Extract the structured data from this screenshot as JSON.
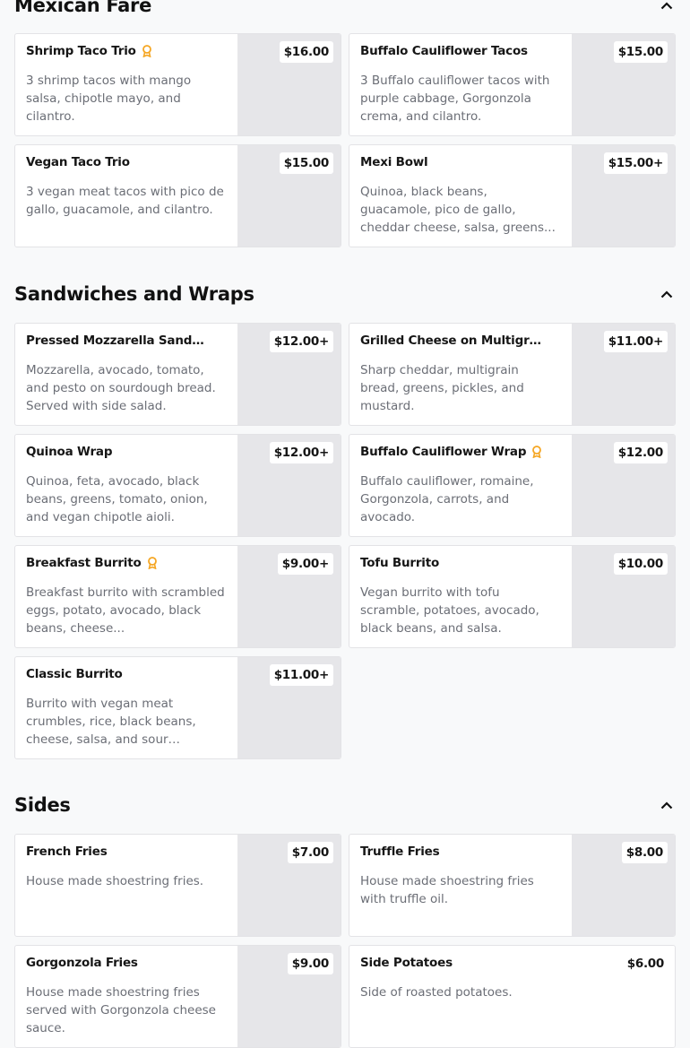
{
  "sections": [
    {
      "title": "Mexican Fare",
      "items": [
        {
          "name": "Shrimp Taco Trio",
          "desc": "3 shrimp tacos with mango salsa, chipotle mayo, and cilantro.",
          "price": "$16.00"
        },
        {
          "name": "Buffalo Cauliflower Tacos",
          "desc": "3 Buffalo cauliflower tacos with purple cabbage, Gorgonzola crema, and cilantro.",
          "price": "$15.00"
        },
        {
          "name": "Vegan Taco Trio",
          "desc": "3 vegan meat tacos with pico de gallo, guacamole, and cilantro.",
          "price": "$15.00"
        },
        {
          "name": "Mexi Bowl",
          "desc": "Quinoa, black beans, guacamole, pico de gallo, cheddar cheese, salsa, greens...",
          "price": "$15.00+"
        }
      ]
    },
    {
      "title": "Sandwiches and Wraps",
      "items": [
        {
          "name": "Pressed Mozzarella Sandwi...",
          "desc": "Mozzarella, avocado, tomato, and pesto on sourdough bread. Served with side salad.",
          "price": "$12.00+"
        },
        {
          "name": "Grilled Cheese on Multigrain",
          "desc": "Sharp cheddar, multigrain bread, greens, pickles, and mustard.",
          "price": "$11.00+"
        },
        {
          "name": "Quinoa Wrap",
          "desc": "Quinoa, feta, avocado, black beans, greens, tomato, onion, and vegan chipotle aioli.",
          "price": "$12.00+"
        },
        {
          "name": "Buffalo Cauliflower Wrap",
          "desc": "Buffalo cauliflower, romaine, Gorgonzola, carrots, and avocado.",
          "price": "$12.00"
        },
        {
          "name": "Breakfast Burrito",
          "desc": "Breakfast burrito with scrambled eggs, potato, avocado, black beans, cheese...",
          "price": "$9.00+"
        },
        {
          "name": "Tofu Burrito",
          "desc": "Vegan burrito with tofu scramble, potatoes, avocado, black beans, and salsa.",
          "price": "$10.00"
        },
        {
          "name": "Classic Burrito",
          "desc": "Burrito with vegan meat crumbles, rice, black beans, cheese, salsa, and sour cream....",
          "price": "$11.00+"
        }
      ]
    },
    {
      "title": "Sides",
      "items": [
        {
          "name": "French Fries",
          "desc": "House made shoestring fries.",
          "price": "$7.00"
        },
        {
          "name": "Truffle Fries",
          "desc": "House made shoestring fries with truffle oil.",
          "price": "$8.00"
        },
        {
          "name": "Gorgonzola Fries",
          "desc": "House made shoestring fries served with Gorgonzola cheese sauce.",
          "price": "$9.00"
        },
        {
          "name": "Side Potatoes",
          "desc": "Side of roasted potatoes.",
          "price": "$6.00"
        }
      ]
    }
  ],
  "icons": {
    "award": "award-ribbon-icon",
    "collapse": "chevron-up-icon"
  },
  "colors": {
    "award": "#f5a623",
    "photo_placeholder": "#e6e6e9",
    "background": "#f8f9fa"
  }
}
